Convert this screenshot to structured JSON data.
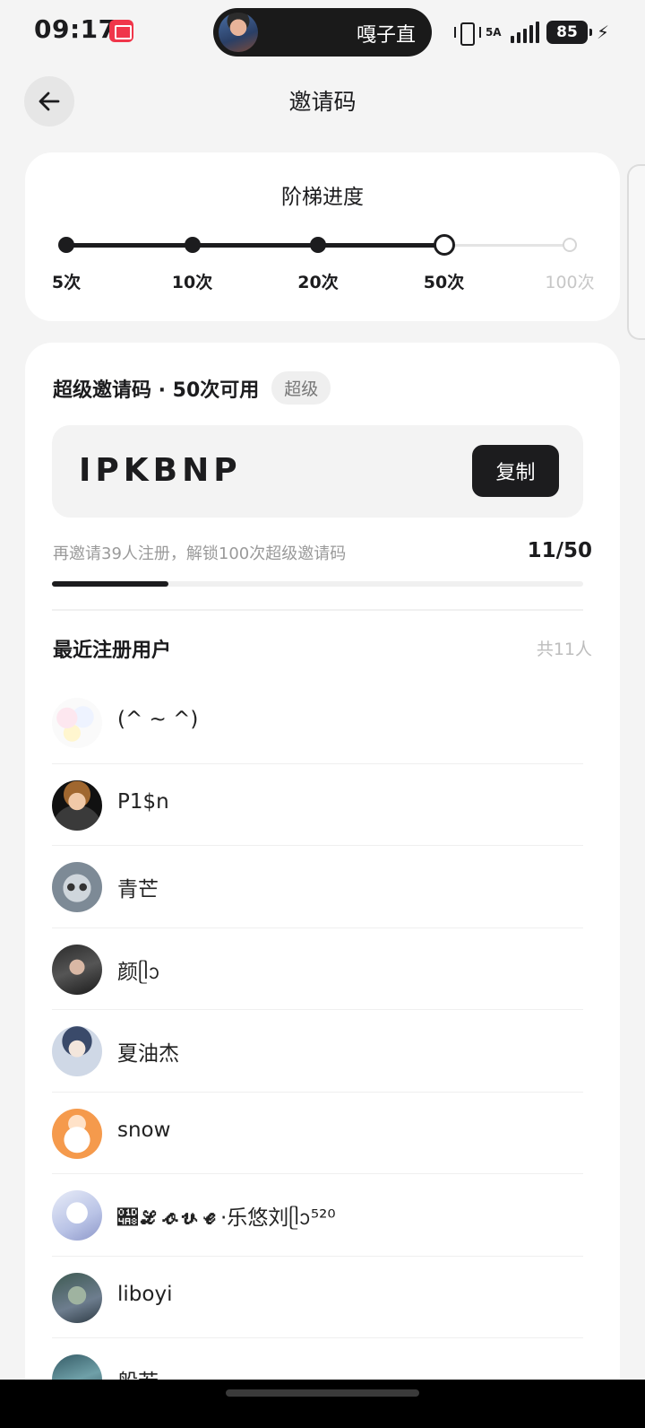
{
  "status_bar": {
    "time": "09:17",
    "island_text": "嘎子直",
    "network": "5A",
    "battery": "85"
  },
  "header": {
    "title": "邀请码"
  },
  "ladder": {
    "title": "阶梯进度",
    "steps": [
      {
        "label": "5次",
        "state": "done"
      },
      {
        "label": "10次",
        "state": "done"
      },
      {
        "label": "20次",
        "state": "done"
      },
      {
        "label": "50次",
        "state": "current"
      },
      {
        "label": "100次",
        "state": "todo"
      }
    ]
  },
  "invite": {
    "title": "超级邀请码 · 50次可用",
    "badge": "超级",
    "code": "IPKBNP",
    "copy_label": "复制",
    "hint": "再邀请39人注册，解锁100次超级邀请码",
    "progress_text": "11/50",
    "progress_value": 0.22
  },
  "recent": {
    "title": "最近注册用户",
    "count_text": "共11人",
    "users": [
      {
        "name": "(^ ~ ^)"
      },
      {
        "name": "P1$n"
      },
      {
        "name": "青芒"
      },
      {
        "name": "颜ᥫᩣ"
      },
      {
        "name": "夏油杰"
      },
      {
        "name": "snow"
      },
      {
        "name": "𝒨𝓛𝓸𝓿𝓮·乐悠刘ᥫᩣ⁵²⁰"
      },
      {
        "name": "liboyi"
      },
      {
        "name": "般若"
      }
    ]
  },
  "colors": {
    "accent": "#1c1c1e",
    "background": "#f4f4f4",
    "card": "#ffffff",
    "muted": "#9a9a9a"
  }
}
